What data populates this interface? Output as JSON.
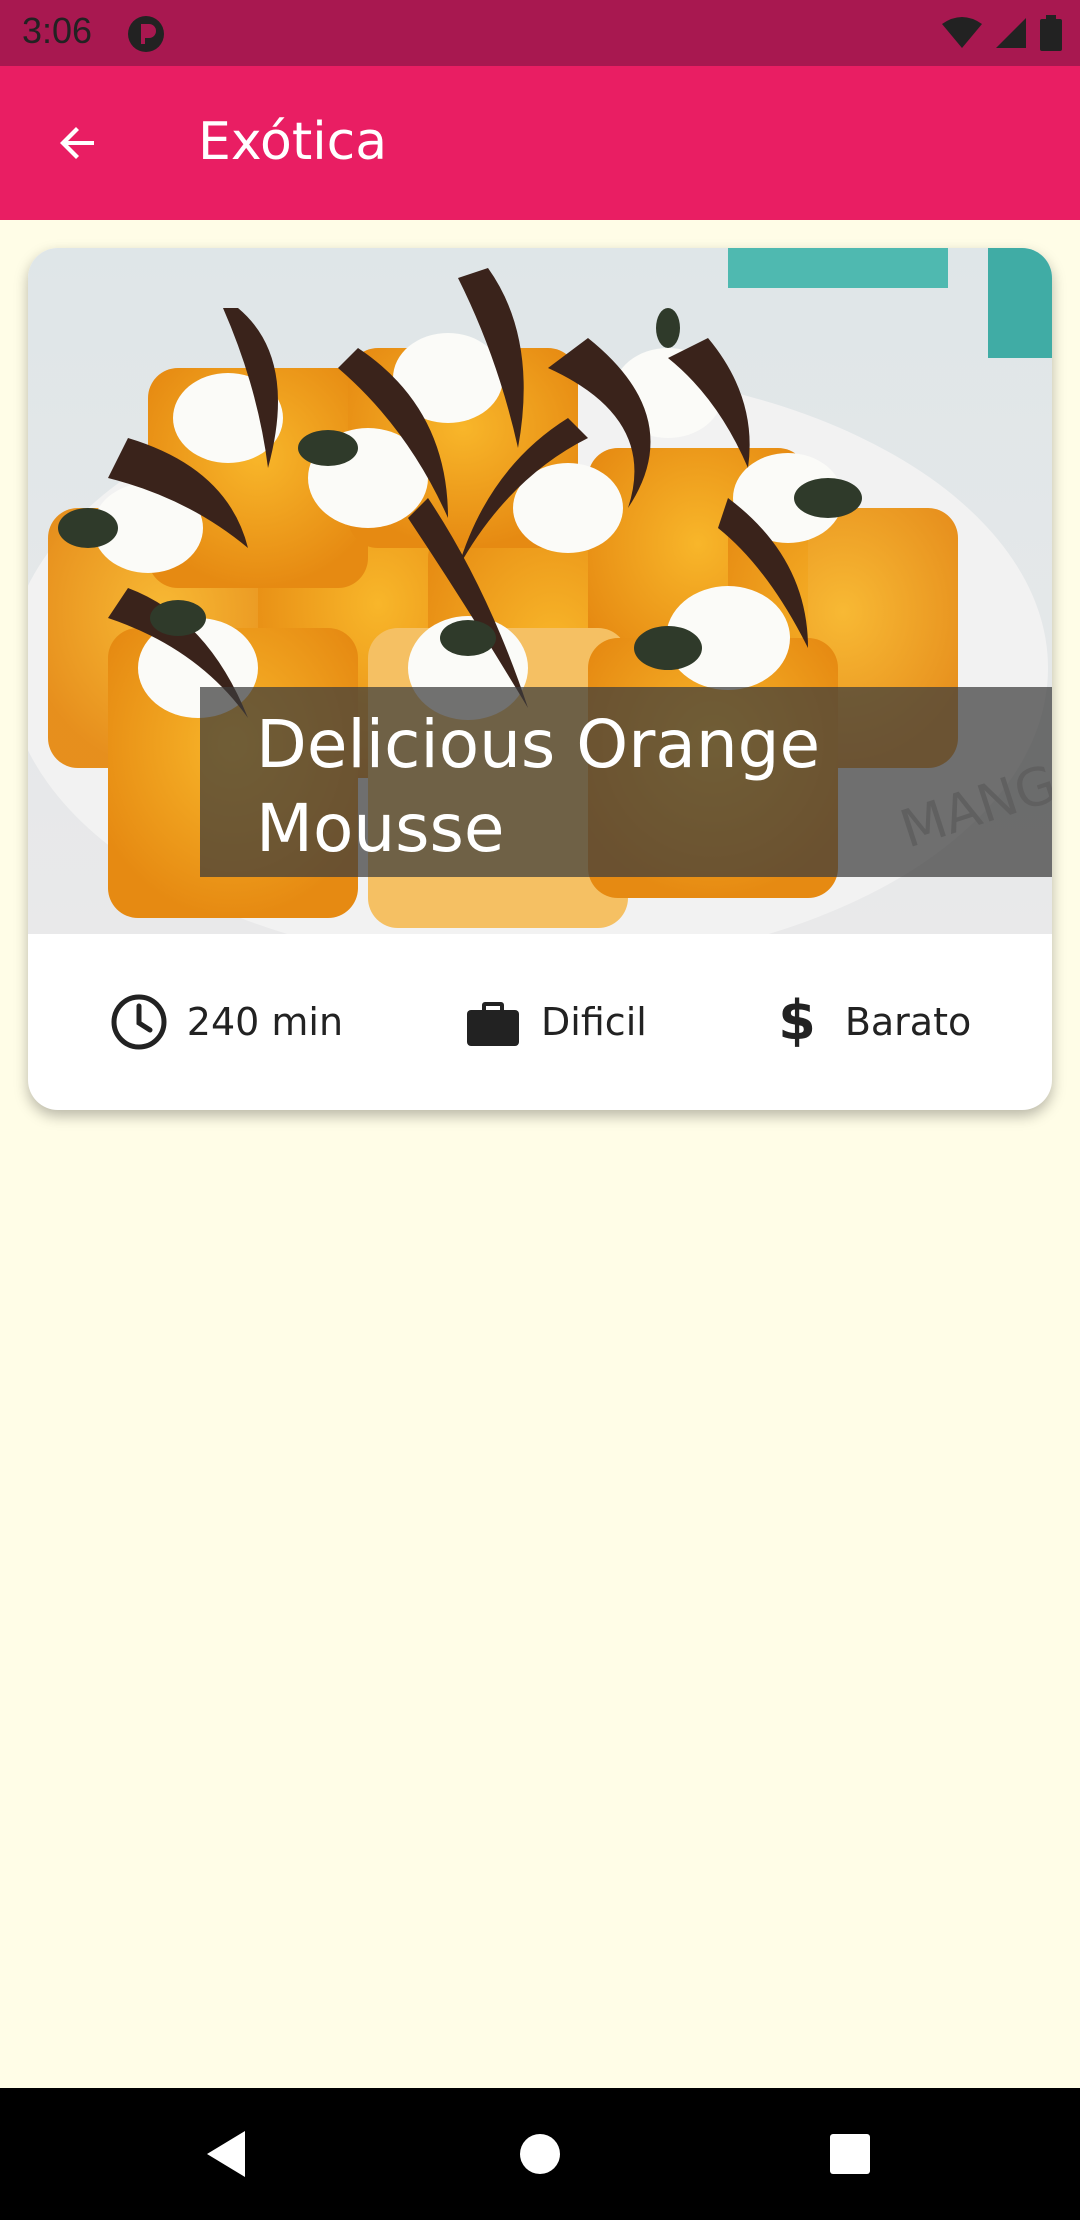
{
  "status_bar": {
    "time": "3:06"
  },
  "app_bar": {
    "title": "Exótica",
    "back_icon": "arrow-back-icon"
  },
  "recipe": {
    "title": "Delicious Orange Mousse",
    "duration": "240 min",
    "difficulty": "Dificil",
    "price": "Barato",
    "icons": {
      "duration": "clock-icon",
      "difficulty": "briefcase-icon",
      "price": "dollar-icon"
    }
  },
  "colors": {
    "status_bar": "#A81850",
    "app_bar": "#E91E63",
    "background": "#FFFDE7"
  }
}
